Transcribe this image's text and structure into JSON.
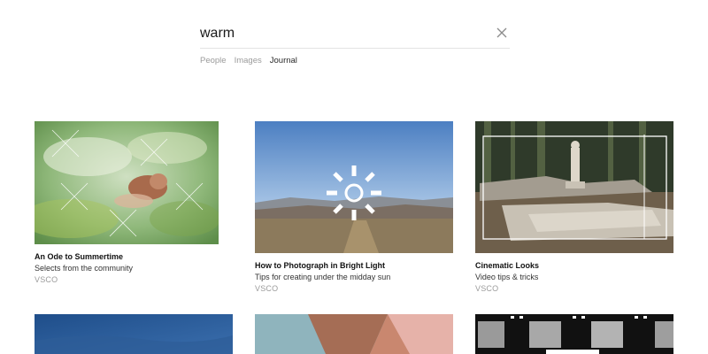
{
  "search": {
    "query": "warm"
  },
  "tabs": [
    {
      "label": "People",
      "active": false
    },
    {
      "label": "Images",
      "active": false
    },
    {
      "label": "Journal",
      "active": true
    }
  ],
  "cards": [
    {
      "title": "An Ode to Summertime",
      "subtitle": "Selects from the community",
      "source": "VSCO"
    },
    {
      "title": "How to Photograph in Bright Light",
      "subtitle": "Tips for creating under the midday sun",
      "source": "VSCO"
    },
    {
      "title": "Cinematic Looks",
      "subtitle": "Video tips & tricks",
      "source": "VSCO"
    }
  ],
  "icons": {
    "clear": "close-icon",
    "sun": "sun-icon"
  }
}
